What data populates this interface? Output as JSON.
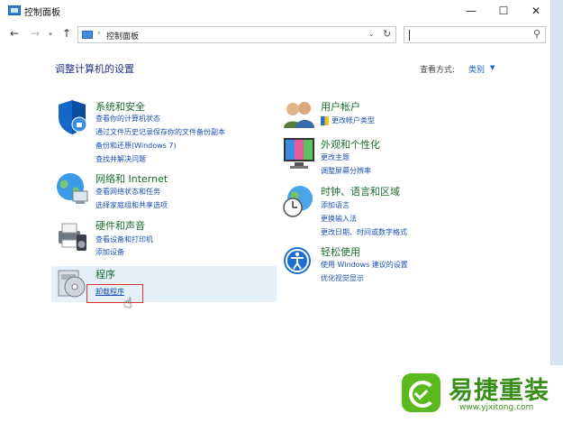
{
  "window": {
    "title": "控制面板"
  },
  "address": {
    "path": "控制面板",
    "separator": "›"
  },
  "search": {
    "placeholder": ""
  },
  "content": {
    "heading": "调整计算机的设置",
    "view_by_label": "查看方式:",
    "view_by_value": "类别"
  },
  "categories": [
    {
      "title": "系统和安全",
      "links": [
        "查看你的计算机状态",
        "通过文件历史记录保存你的文件备份副本",
        "备份和还原(Windows 7)",
        "查找并解决问题"
      ]
    },
    {
      "title": "网络和 Internet",
      "links": [
        "查看网络状态和任务",
        "选择家庭组和共享选项"
      ]
    },
    {
      "title": "硬件和声音",
      "links": [
        "查看设备和打印机",
        "添加设备"
      ]
    },
    {
      "title": "程序",
      "links": [
        "卸载程序"
      ]
    },
    {
      "title": "用户帐户",
      "links": [
        "更改帐户类型"
      ]
    },
    {
      "title": "外观和个性化",
      "links": [
        "更改主题",
        "调整屏幕分辨率"
      ]
    },
    {
      "title": "时钟、语言和区域",
      "links": [
        "添加语言",
        "更换输入法",
        "更改日期、时间或数字格式"
      ]
    },
    {
      "title": "轻松使用",
      "links": [
        "使用 Windows 建议的设置",
        "优化视觉显示"
      ]
    }
  ],
  "watermark": {
    "brand": "易捷重装",
    "url": "www.yjxitong.com"
  },
  "colors": {
    "category_title": "#1d6b2e",
    "link": "#1a4fb0",
    "heading": "#1e3287",
    "highlight": "#e4f1fb",
    "annotation": "#e23030",
    "brand": "#3a8f1a"
  }
}
